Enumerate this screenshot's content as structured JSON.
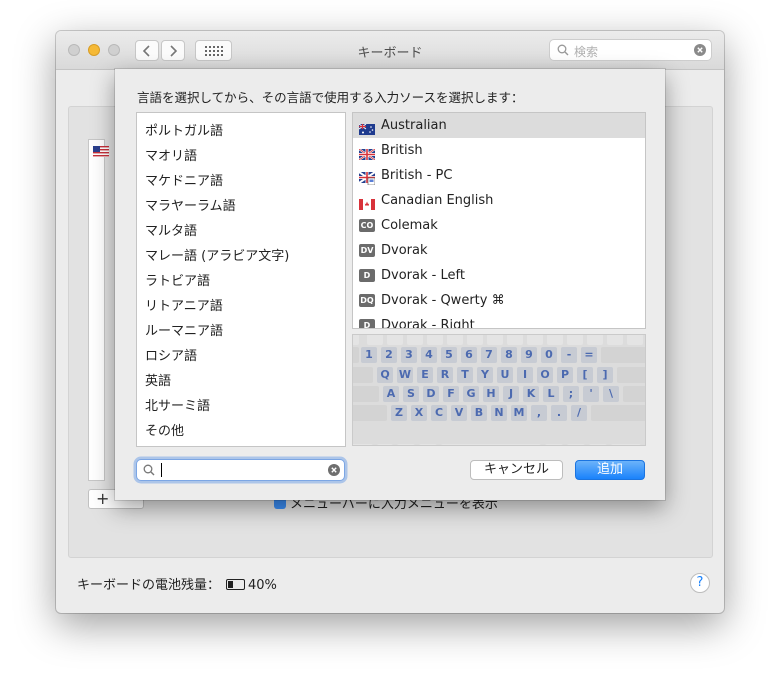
{
  "window": {
    "title": "キーボード",
    "search_placeholder": "検索"
  },
  "background": {
    "show_menu_checkbox_label": "メニューバーに入力メニューを表示",
    "add_button": "+",
    "battery_label": "キーボードの電池残量：",
    "battery_value": "40%",
    "help_label": "?"
  },
  "sheet": {
    "prompt": "言語を選択してから、その言語で使用する入力ソースを選択します：",
    "languages": [
      "ポルトガル語",
      "マオリ語",
      "マケドニア語",
      "マラヤーラム語",
      "マルタ語",
      "マレー語 (アラビア文字)",
      "ラトビア語",
      "リトアニア語",
      "ルーマニア語",
      "ロシア語",
      "英語",
      "北サーミ語",
      "その他"
    ],
    "sources": [
      {
        "label": "Australian",
        "icon": "flag-au-icon",
        "selected": true
      },
      {
        "label": "British",
        "icon": "flag-uk-icon"
      },
      {
        "label": "British - PC",
        "icon": "flag-uk-pc-icon"
      },
      {
        "label": "Canadian English",
        "icon": "flag-ca-icon"
      },
      {
        "label": "Colemak",
        "icon": "colemak-icon",
        "badge": "CO"
      },
      {
        "label": "Dvorak",
        "icon": "dvorak-icon",
        "badge": "DV"
      },
      {
        "label": "Dvorak - Left",
        "icon": "dvorak-left-icon",
        "badge": "D"
      },
      {
        "label": "Dvorak - Qwerty ⌘",
        "icon": "dvorak-qwerty-icon",
        "badge": "DQ"
      },
      {
        "label": "Dvorak - Right",
        "icon": "dvorak-right-icon",
        "badge": "D"
      }
    ],
    "keyboard_rows": [
      [
        "1",
        "2",
        "3",
        "4",
        "5",
        "6",
        "7",
        "8",
        "9",
        "0",
        "-",
        "="
      ],
      [
        "Q",
        "W",
        "E",
        "R",
        "T",
        "Y",
        "U",
        "I",
        "O",
        "P",
        "[",
        "]"
      ],
      [
        "A",
        "S",
        "D",
        "F",
        "G",
        "H",
        "J",
        "K",
        "L",
        ";",
        "'",
        "\\"
      ],
      [
        "Z",
        "X",
        "C",
        "V",
        "B",
        "N",
        "M",
        ",",
        ".",
        "/"
      ]
    ],
    "search_value": "",
    "cancel_label": "キャンセル",
    "add_label": "追加"
  },
  "colors": {
    "accent": "#1a82fb",
    "key_label": "#4c6ab0"
  }
}
